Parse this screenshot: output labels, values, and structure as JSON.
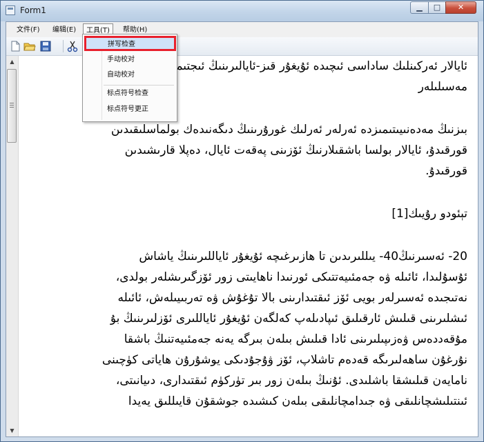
{
  "window": {
    "title": "Form1"
  },
  "menubar": {
    "items": [
      "文件(F)",
      "编辑(E)",
      "工具(T)",
      "帮助(H)"
    ]
  },
  "tools_menu": {
    "items": [
      "拼写检查",
      "手动校对",
      "自动校对",
      "标点符号检查",
      "标点符号更正"
    ],
    "highlighted": "拼写检查"
  },
  "document": {
    "paragraphs": [
      [
        "ئايالار ئەركىنلىك ساداسى ئىچىدە ئۇيغۇر قىز-ئايالىرىنىڭ ئىجتىمائى",
        "مەسىلىلەر"
      ],
      [
        "بىزنىڭ مەدەنىيىتىمىزدە ئەرلەر ئەرلىك غورۇرىنىڭ دىگەنىدەك بولماسلىقىدىن",
        "قورقىدۇ، ئايالار بولسا باشقىلارنىڭ ئۆزىنى پەقەت ئايال، دەپلا قارىشىدىن",
        "قورقىدۇ."
      ],
      [
        "تېئودو رۇيىك[1]"
      ],
      [
        "20- ئەسىرنىڭ40- يىللىرىدىن تا ھازىرغىچە ئۇيغۇر ئاياللىرىنىڭ ياشاش",
        "ئۇسۇلىدا، ئائىلە ۋە جەمئىيەتتىكى ئورنىدا ناھايىتى زور ئۆزگىرىشلەر بولدى،",
        "نەتىجىدە ئەسىرلەر بويى ئۆز ئىقتىدارىنى بالا تۇغۇش ۋە تەربىيىلەش، ئائىلە",
        "ئىشلىرىنى قىلىش ئارقىلىق ئىپادىلەپ كەلگەن ئۇيغۇر ئاياللىرى ئۆزلىرىنىڭ بۇ",
        "مۇقەددەس ۋەزىپىلىرىنى ئادا قىلىش بىلەن بىرگە يەنە جەمئىيەتنىڭ باشقا",
        "نۇرغۇن ساھەلىرىگە قەدەم تاشلاپ، ئۆز ۋۇجۇدىكى يوشۇرۇن ھاياتى كۈچىنى",
        "نامايەن قىلىشقا باشلىدى. ئۇنىڭ بىلەن زور بىر تۈركۈم ئىقتىدارى، دىيانىتى،",
        "ئىنتىلىشچانلىقى ۋە جىدامچانلىقى بىلەن كىشىدە جوشقۇن قايىللىق يەيدا"
      ]
    ]
  }
}
